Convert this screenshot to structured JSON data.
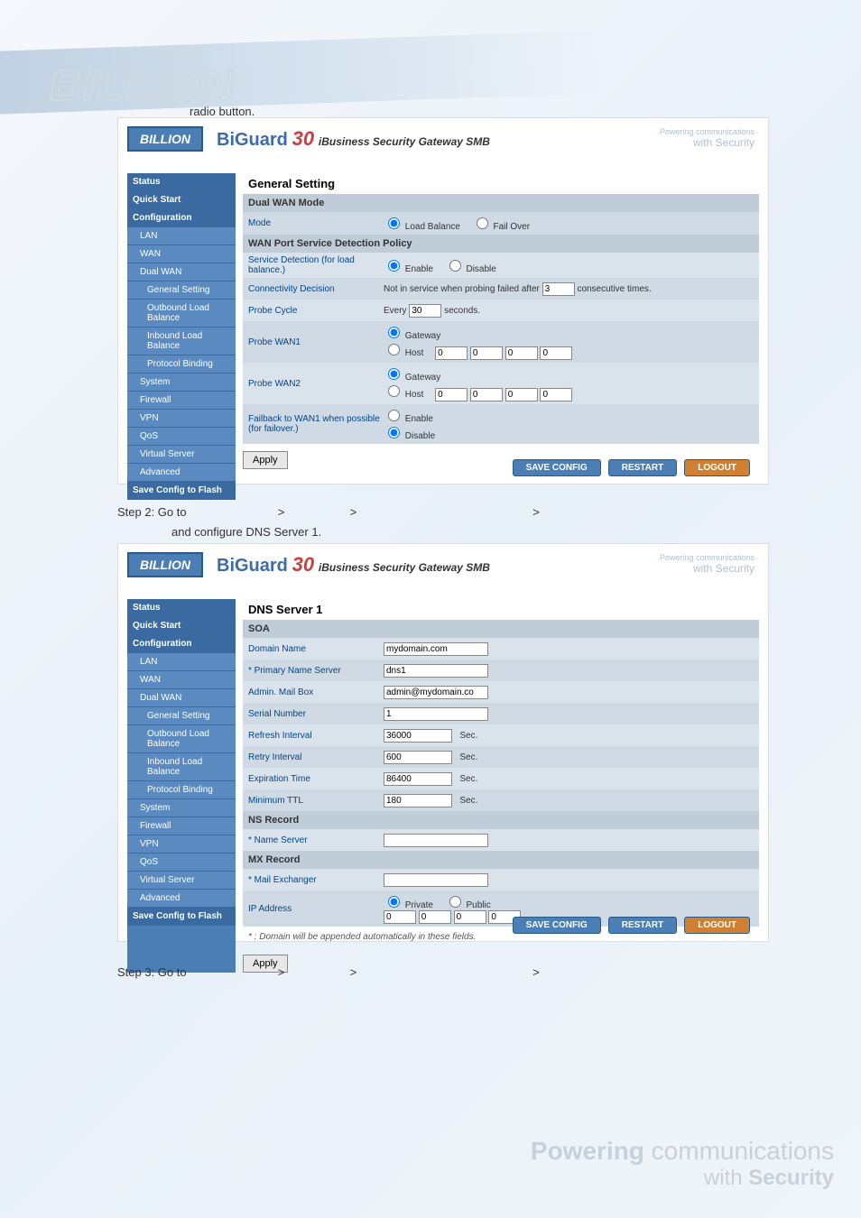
{
  "logo": "BILLION",
  "intro_text": "radio button.",
  "brand": {
    "box": "BILLION",
    "title_bold": "BiGuard",
    "title_num": "30",
    "title_sub": "iBusiness Security Gateway SMB",
    "powering": "Powering communications",
    "withsec": "with Security"
  },
  "sidebar": {
    "items": [
      {
        "label": "Status",
        "cls": "top"
      },
      {
        "label": "Quick Start",
        "cls": "top"
      },
      {
        "label": "Configuration",
        "cls": "top"
      },
      {
        "label": "LAN",
        "cls": "sub"
      },
      {
        "label": "WAN",
        "cls": "sub"
      },
      {
        "label": "Dual WAN",
        "cls": "sub"
      },
      {
        "label": "General Setting",
        "cls": "sub2"
      },
      {
        "label": "Outbound Load Balance",
        "cls": "sub2"
      },
      {
        "label": "Inbound Load Balance",
        "cls": "sub2"
      },
      {
        "label": "Protocol Binding",
        "cls": "sub2"
      },
      {
        "label": "System",
        "cls": "sub"
      },
      {
        "label": "Firewall",
        "cls": "sub"
      },
      {
        "label": "VPN",
        "cls": "sub"
      },
      {
        "label": "QoS",
        "cls": "sub"
      },
      {
        "label": "Virtual Server",
        "cls": "sub"
      },
      {
        "label": "Advanced",
        "cls": "sub"
      },
      {
        "label": "Save Config to Flash",
        "cls": "top"
      }
    ]
  },
  "panel1": {
    "title": "General Setting",
    "sh1": "Dual WAN Mode",
    "mode_label": "Mode",
    "mode_opt1": "Load Balance",
    "mode_opt2": "Fail Over",
    "sh2": "WAN Port Service Detection Policy",
    "sd_label": "Service Detection (for load balance.)",
    "sd_opt1": "Enable",
    "sd_opt2": "Disable",
    "cd_label": "Connectivity Decision",
    "cd_text1": "Not in service when probing failed after",
    "cd_val": "3",
    "cd_text2": "consecutive times.",
    "pc_label": "Probe Cycle",
    "pc_text1": "Every",
    "pc_val": "30",
    "pc_text2": "seconds.",
    "pw1_label": "Probe WAN1",
    "pw2_label": "Probe WAN2",
    "gw_opt": "Gateway",
    "host_opt": "Host",
    "ip": "0",
    "fb_label": "Failback to WAN1 when possible (for failover.)",
    "fb_opt1": "Enable",
    "fb_opt2": "Disable",
    "apply": "Apply"
  },
  "panel2": {
    "title": "DNS Server 1",
    "sh1": "SOA",
    "domain_label": "Domain Name",
    "domain_val": "mydomain.com",
    "pns_label": "* Primary Name Server",
    "pns_val": "dns1",
    "amb_label": "Admin. Mail Box",
    "amb_val": "admin@mydomain.co",
    "sn_label": "Serial Number",
    "sn_val": "1",
    "ri_label": "Refresh Interval",
    "ri_val": "36000",
    "ri_unit": "Sec.",
    "rt_label": "Retry Interval",
    "rt_val": "600",
    "rt_unit": "Sec.",
    "et_label": "Expiration Time",
    "et_val": "86400",
    "et_unit": "Sec.",
    "mt_label": "Minimum TTL",
    "mt_val": "180",
    "mt_unit": "Sec.",
    "sh2": "NS Record",
    "ns_label": "* Name Server",
    "sh3": "MX Record",
    "mx_label": "* Mail Exchanger",
    "ipa_label": "IP Address",
    "ipa_opt1": "Private",
    "ipa_opt2": "Public",
    "ip": "0",
    "note": "* : Domain will be appended automatically in these fields.",
    "apply": "Apply"
  },
  "footer": {
    "save": "SAVE CONFIG",
    "restart": "RESTART",
    "logout": "LOGOUT"
  },
  "steps": {
    "s2": "Step 2: Go to",
    "s2gt1": ">",
    "s2gt2": ">",
    "s2gt3": ">",
    "s2b": "and configure DNS Server 1.",
    "s3": "Step 3: Go to"
  },
  "big_powering": {
    "line1a": "Powering",
    "line1b": " communications",
    "line2a": "with ",
    "line2b": "Security"
  }
}
